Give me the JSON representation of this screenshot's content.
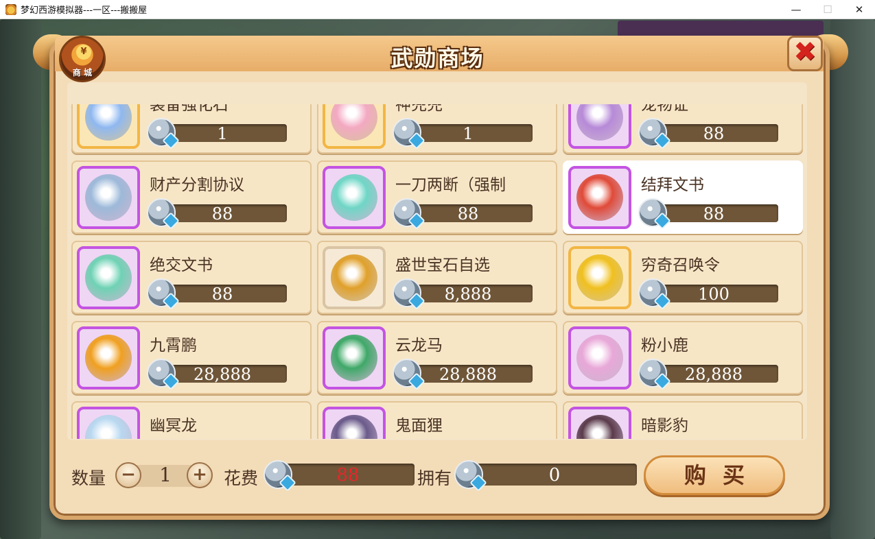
{
  "window": {
    "title": "梦幻西游模拟器---一区---搬搬屋",
    "controls": {
      "minimize": "—",
      "maximize": "☐",
      "close": "✕"
    }
  },
  "shop": {
    "title": "武勋商场",
    "badge_label": "商 城",
    "badge_coin": "¥",
    "close_icon": "✖",
    "currency_icon": "silver-gem-icon",
    "items": [
      {
        "name": "装备强化石",
        "price": "1",
        "frame": "gold",
        "art": "#8fb8f0",
        "selected": false
      },
      {
        "name": "神兜兜",
        "price": "1",
        "frame": "gold",
        "art": "#f3a9c2",
        "selected": false
      },
      {
        "name": "宠物证",
        "price": "88",
        "frame": "purple",
        "art": "#b78ad8",
        "selected": false
      },
      {
        "name": "财产分割协议",
        "price": "88",
        "frame": "purple",
        "art": "#9db9d9",
        "selected": false
      },
      {
        "name": "一刀两断（强制",
        "price": "88",
        "frame": "purple",
        "art": "#6fd6c6",
        "selected": false
      },
      {
        "name": "结拜文书",
        "price": "88",
        "frame": "purple",
        "art": "#e04a38",
        "selected": true
      },
      {
        "name": "绝交文书",
        "price": "88",
        "frame": "purple",
        "art": "#6fd2b4",
        "selected": false
      },
      {
        "name": "盛世宝石自选",
        "price": "8,888",
        "frame": "tan",
        "art": "#e0a02a",
        "selected": false
      },
      {
        "name": "穷奇召唤令",
        "price": "100",
        "frame": "gold",
        "art": "#f0c020",
        "selected": false
      },
      {
        "name": "九霄鹏",
        "price": "28,888",
        "frame": "purple",
        "art": "#f0a020",
        "selected": false
      },
      {
        "name": "云龙马",
        "price": "28,888",
        "frame": "purple",
        "art": "#3fa868",
        "selected": false
      },
      {
        "name": "粉小鹿",
        "price": "28,888",
        "frame": "purple",
        "art": "#e8a8d8",
        "selected": false
      },
      {
        "name": "幽冥龙",
        "price": "",
        "frame": "purple",
        "art": "#b8d8f0",
        "selected": false
      },
      {
        "name": "鬼面狸",
        "price": "",
        "frame": "purple",
        "art": "#6a5a8a",
        "selected": false
      },
      {
        "name": "暗影豹",
        "price": "",
        "frame": "purple",
        "art": "#5a3a4a",
        "selected": false
      }
    ],
    "footer": {
      "quantity_label": "数量",
      "quantity_minus": "−",
      "quantity": "1",
      "quantity_plus": "+",
      "cost_label": "花费",
      "cost": "88",
      "cost_color": "#e8262a",
      "owned_label": "拥有",
      "owned": "0",
      "buy_label": "购买"
    }
  }
}
